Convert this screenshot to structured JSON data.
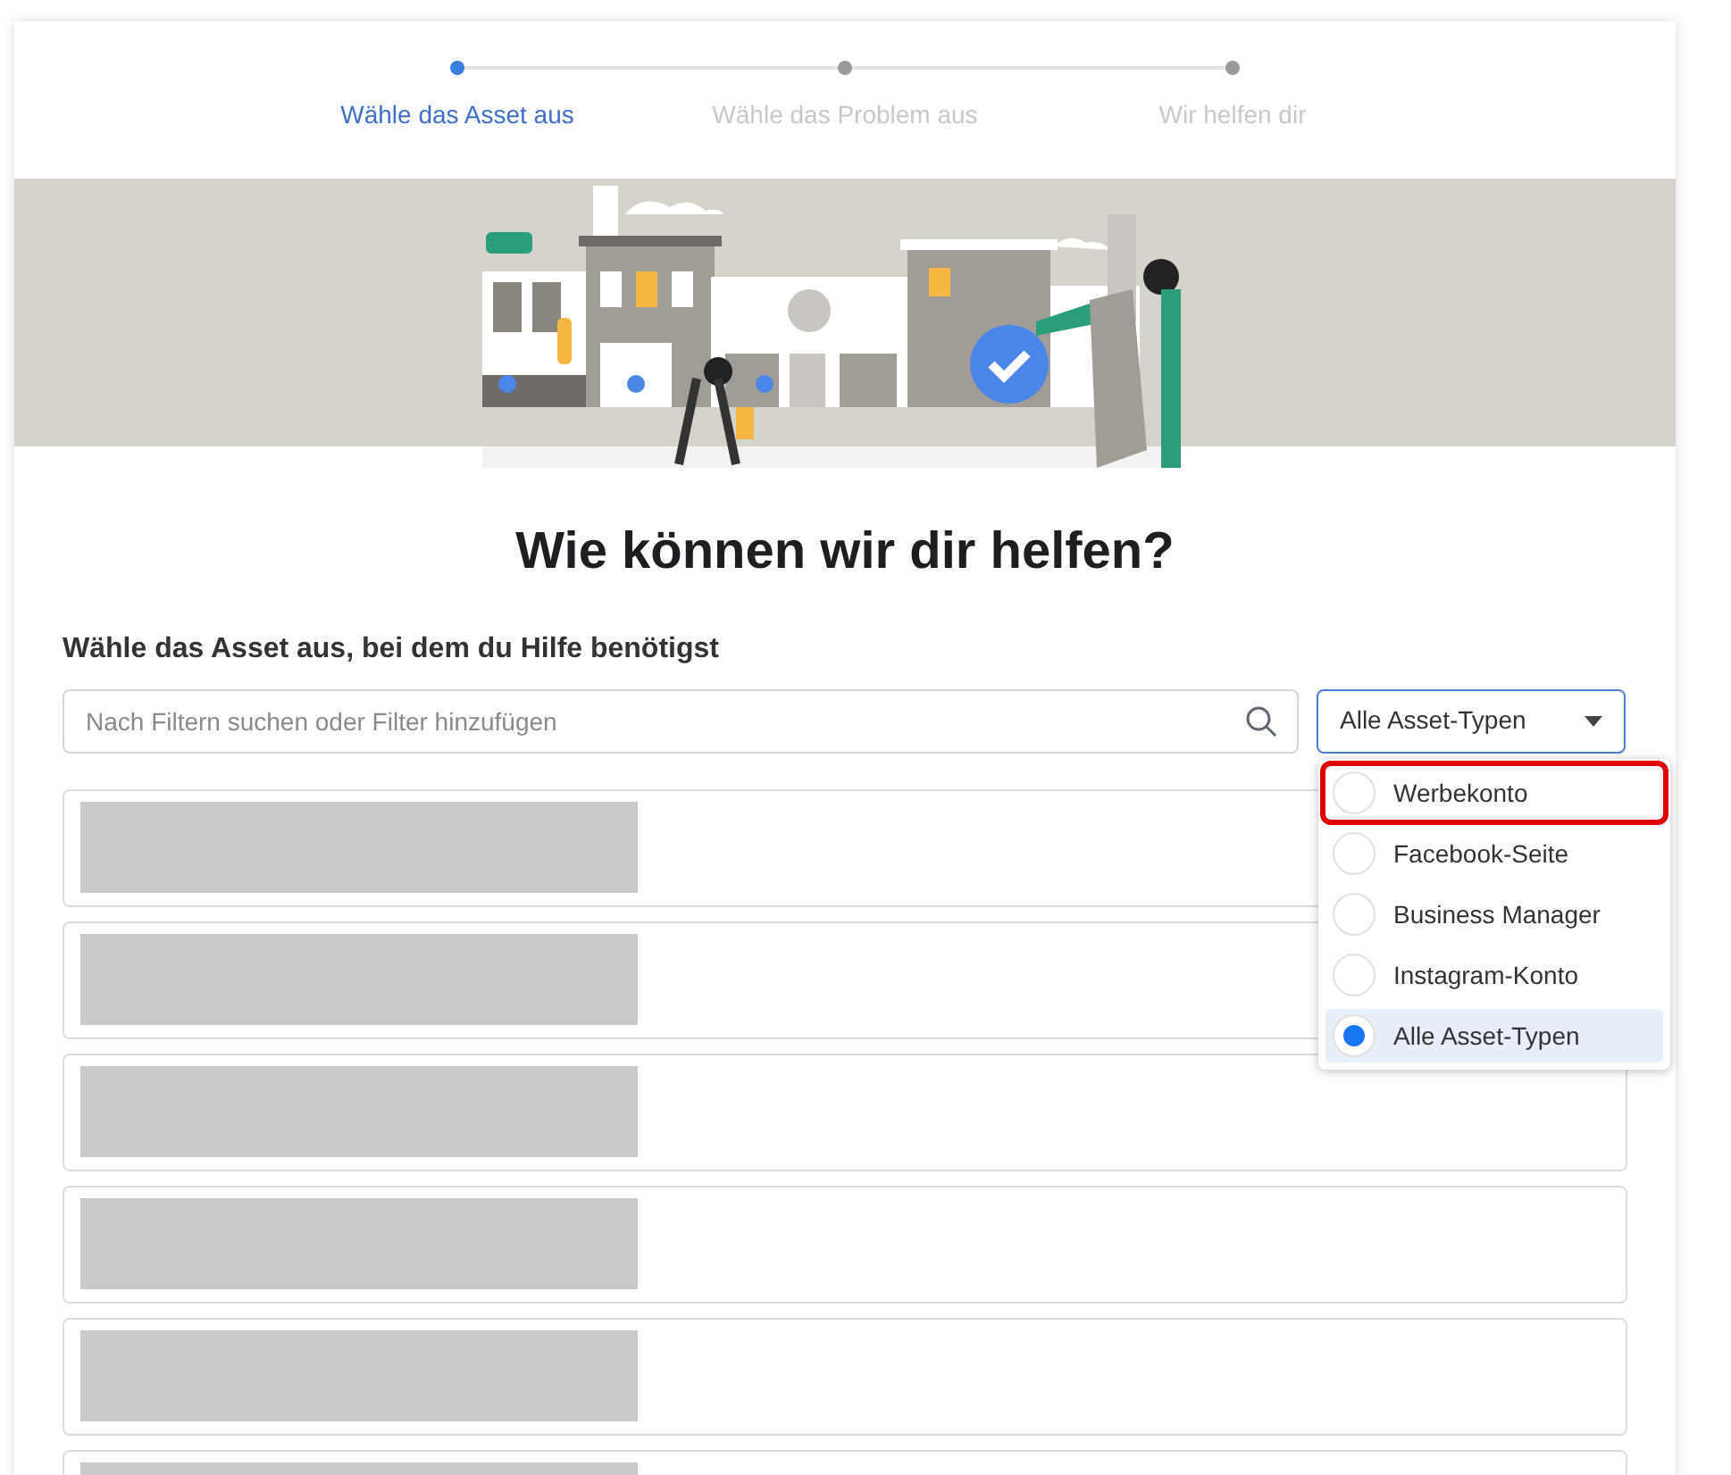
{
  "steps": [
    {
      "label": "Wähle das Asset aus",
      "selected": true
    },
    {
      "label": "Wähle das Problem aus",
      "selected": false
    },
    {
      "label": "Wir helfen dir",
      "selected": false
    }
  ],
  "heading": "Wie können wir dir helfen?",
  "subheading": "Wähle das Asset aus, bei dem du Hilfe benötigst",
  "search": {
    "placeholder": "Nach Filtern suchen oder Filter hinzufügen"
  },
  "asset_type_select": {
    "value": "Alle Asset-Typen",
    "expanded": true,
    "options": [
      {
        "label": "Werbekonto",
        "selected": false,
        "highlighted": true
      },
      {
        "label": "Facebook-Seite",
        "selected": false,
        "highlighted": false
      },
      {
        "label": "Business Manager",
        "selected": false,
        "highlighted": false
      },
      {
        "label": "Instagram-Konto",
        "selected": false,
        "highlighted": false
      },
      {
        "label": "Alle Asset-Typen",
        "selected": true,
        "highlighted": false
      }
    ]
  },
  "asset_rows": [
    {
      "redacted": true
    },
    {
      "redacted": true
    },
    {
      "redacted": true
    },
    {
      "redacted": true
    },
    {
      "redacted": true
    },
    {
      "redacted": true
    }
  ]
}
